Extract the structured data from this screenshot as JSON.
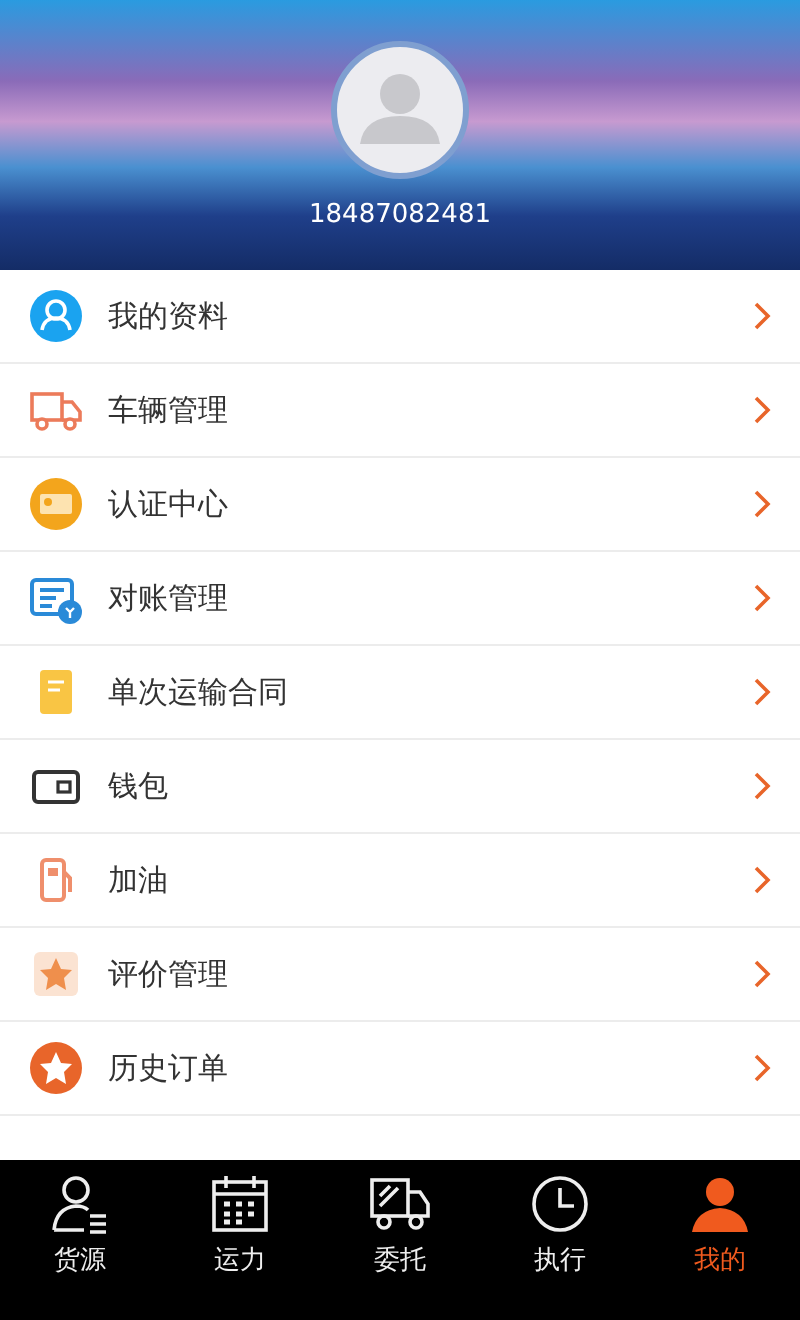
{
  "profile": {
    "phone": "18487082481"
  },
  "menu": [
    {
      "label": "我的资料"
    },
    {
      "label": "车辆管理"
    },
    {
      "label": "认证中心"
    },
    {
      "label": "对账管理"
    },
    {
      "label": "单次运输合同"
    },
    {
      "label": "钱包"
    },
    {
      "label": "加油"
    },
    {
      "label": "评价管理"
    },
    {
      "label": "历史订单"
    }
  ],
  "tab_bar": [
    {
      "label": "货源",
      "selected": false
    },
    {
      "label": "运力",
      "selected": false
    },
    {
      "label": "委托",
      "selected": false
    },
    {
      "label": "执行",
      "selected": false
    },
    {
      "label": "我的",
      "selected": true
    }
  ]
}
